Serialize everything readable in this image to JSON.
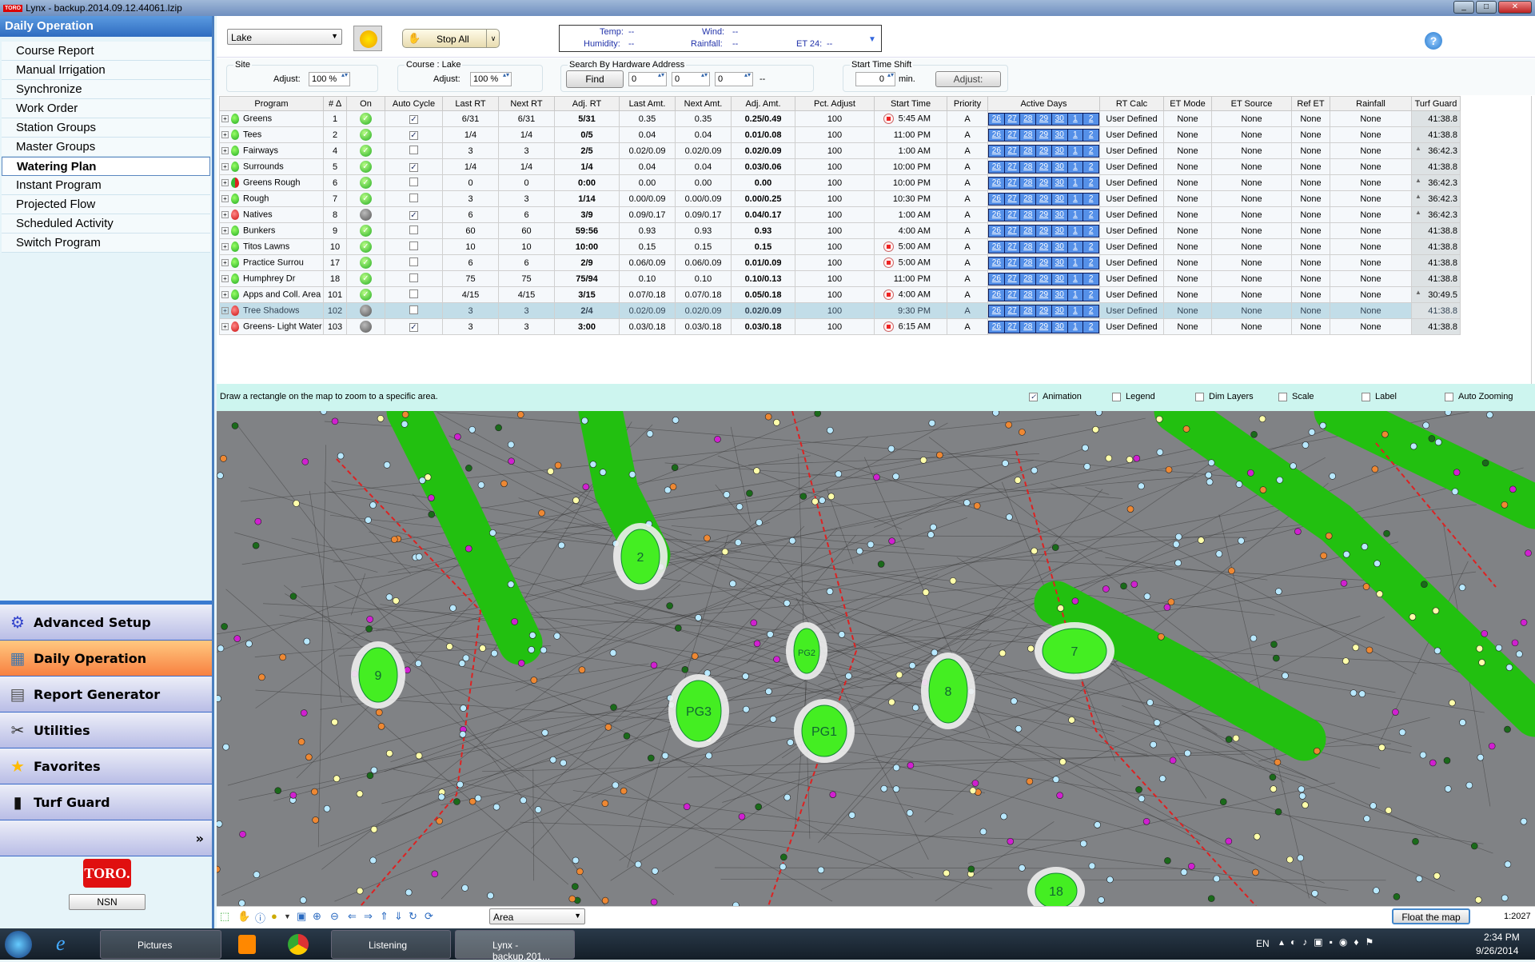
{
  "window": {
    "title": "Lynx - backup.2014.09.12.44061.lzip",
    "logo": "TORO"
  },
  "sidebar": {
    "header": "Daily Operation",
    "items": [
      {
        "label": "Course Report"
      },
      {
        "label": "Manual Irrigation"
      },
      {
        "label": "Synchronize"
      },
      {
        "label": "Work Order"
      },
      {
        "label": "Station Groups"
      },
      {
        "label": "Master Groups"
      },
      {
        "label": "Watering Plan",
        "selected": true
      },
      {
        "label": "Instant Program"
      },
      {
        "label": "Projected Flow"
      },
      {
        "label": "Scheduled Activity"
      },
      {
        "label": "Switch Program"
      }
    ],
    "modules": [
      {
        "label": "Advanced Setup",
        "icon": "gear-icon"
      },
      {
        "label": "Daily Operation",
        "icon": "calendar-icon",
        "active": true
      },
      {
        "label": "Report Generator",
        "icon": "report-icon"
      },
      {
        "label": "Utilities",
        "icon": "tools-icon"
      },
      {
        "label": "Favorites",
        "icon": "star-icon"
      },
      {
        "label": "Turf Guard",
        "icon": "sensor-icon"
      }
    ],
    "more": "»",
    "logo": "TORO.",
    "nsn_button": "NSN"
  },
  "toolbar": {
    "site_select": "Lake",
    "stop_all": "Stop All",
    "weather": {
      "temp_label": "Temp:",
      "temp": "--",
      "wind_label": "Wind:",
      "wind": "--",
      "humidity_label": "Humidity:",
      "humidity": "--",
      "rainfall_label": "Rainfall:",
      "rainfall": "--",
      "et24_label": "ET 24:",
      "et24": "--"
    },
    "help": "?"
  },
  "filters": {
    "site": {
      "legend": "Site",
      "adjust_label": "Adjust:",
      "adjust": "100 %"
    },
    "course": {
      "legend": "Course : Lake",
      "adjust_label": "Adjust:",
      "adjust": "100 %"
    },
    "hardware": {
      "legend": "Search By Hardware Address",
      "find": "Find",
      "a": "0",
      "b": "0",
      "c": "0",
      "dash": "--"
    },
    "shift": {
      "legend": "Start Time Shift",
      "value": "0",
      "unit": "min.",
      "adjust": "Adjust:"
    }
  },
  "table": {
    "columns": [
      "Program",
      "# ∆",
      "On",
      "Auto Cycle",
      "Last RT",
      "Next RT",
      "Adj. RT",
      "Last Amt.",
      "Next Amt.",
      "Adj. Amt.",
      "Pct. Adjust",
      "Start Time",
      "Priority",
      "Active Days",
      "RT Calc",
      "ET Mode",
      "ET Source",
      "Ref ET",
      "Rainfall",
      "Turf Guard"
    ],
    "days": [
      "26",
      "27",
      "28",
      "29",
      "30",
      "1",
      "2"
    ],
    "rows": [
      {
        "drop": "green",
        "program": "Greens",
        "num": "1",
        "on": true,
        "auto": true,
        "last_rt": "6/31",
        "next_rt": "6/31",
        "adj_rt": "5/31",
        "last_amt": "0.35",
        "next_amt": "0.35",
        "adj_amt": "0.25/0.49",
        "pct": "100",
        "stop": true,
        "start": "5:45 AM",
        "priority": "A",
        "rt_calc": "User Defined",
        "et_mode": "None",
        "et_source": "None",
        "ref_et": "None",
        "rainfall": "None",
        "turf": "41:38.8",
        "up": false
      },
      {
        "drop": "green",
        "program": "Tees",
        "num": "2",
        "on": true,
        "auto": true,
        "last_rt": "1/4",
        "next_rt": "1/4",
        "adj_rt": "0/5",
        "last_amt": "0.04",
        "next_amt": "0.04",
        "adj_amt": "0.01/0.08",
        "pct": "100",
        "stop": false,
        "start": "11:00 PM",
        "priority": "A",
        "rt_calc": "User Defined",
        "et_mode": "None",
        "et_source": "None",
        "ref_et": "None",
        "rainfall": "None",
        "turf": "41:38.8",
        "up": false
      },
      {
        "drop": "green",
        "program": "Fairways",
        "num": "4",
        "on": true,
        "auto": false,
        "last_rt": "3",
        "next_rt": "3",
        "adj_rt": "2/5",
        "last_amt": "0.02/0.09",
        "next_amt": "0.02/0.09",
        "adj_amt": "0.02/0.09",
        "pct": "100",
        "stop": false,
        "start": "1:00 AM",
        "priority": "A",
        "rt_calc": "User Defined",
        "et_mode": "None",
        "et_source": "None",
        "ref_et": "None",
        "rainfall": "None",
        "turf": "36:42.3",
        "up": true
      },
      {
        "drop": "green",
        "program": "Surrounds",
        "num": "5",
        "on": true,
        "auto": true,
        "last_rt": "1/4",
        "next_rt": "1/4",
        "adj_rt": "1/4",
        "last_amt": "0.04",
        "next_amt": "0.04",
        "adj_amt": "0.03/0.06",
        "pct": "100",
        "stop": false,
        "start": "10:00 PM",
        "priority": "A",
        "rt_calc": "User Defined",
        "et_mode": "None",
        "et_source": "None",
        "ref_et": "None",
        "rainfall": "None",
        "turf": "41:38.8",
        "up": false
      },
      {
        "drop": "mixed",
        "program": "Greens Rough",
        "num": "6",
        "on": true,
        "auto": false,
        "last_rt": "0",
        "next_rt": "0",
        "adj_rt": "0:00",
        "last_amt": "0.00",
        "next_amt": "0.00",
        "adj_amt": "0.00",
        "pct": "100",
        "stop": false,
        "start": "10:00 PM",
        "priority": "A",
        "rt_calc": "User Defined",
        "et_mode": "None",
        "et_source": "None",
        "ref_et": "None",
        "rainfall": "None",
        "turf": "36:42.3",
        "up": true
      },
      {
        "drop": "green",
        "program": "Rough",
        "num": "7",
        "on": true,
        "auto": false,
        "last_rt": "3",
        "next_rt": "3",
        "adj_rt": "1/14",
        "last_amt": "0.00/0.09",
        "next_amt": "0.00/0.09",
        "adj_amt": "0.00/0.25",
        "pct": "100",
        "stop": false,
        "start": "10:30 PM",
        "priority": "A",
        "rt_calc": "User Defined",
        "et_mode": "None",
        "et_source": "None",
        "ref_et": "None",
        "rainfall": "None",
        "turf": "36:42.3",
        "up": true
      },
      {
        "drop": "red",
        "program": "Natives",
        "num": "8",
        "on": false,
        "auto": true,
        "last_rt": "6",
        "next_rt": "6",
        "adj_rt": "3/9",
        "last_amt": "0.09/0.17",
        "next_amt": "0.09/0.17",
        "adj_amt": "0.04/0.17",
        "pct": "100",
        "stop": false,
        "start": "1:00 AM",
        "priority": "A",
        "rt_calc": "User Defined",
        "et_mode": "None",
        "et_source": "None",
        "ref_et": "None",
        "rainfall": "None",
        "turf": "36:42.3",
        "up": true
      },
      {
        "drop": "green",
        "program": "Bunkers",
        "num": "9",
        "on": true,
        "auto": false,
        "last_rt": "60",
        "next_rt": "60",
        "adj_rt": "59:56",
        "last_amt": "0.93",
        "next_amt": "0.93",
        "adj_amt": "0.93",
        "pct": "100",
        "stop": false,
        "start": "4:00 AM",
        "priority": "A",
        "rt_calc": "User Defined",
        "et_mode": "None",
        "et_source": "None",
        "ref_et": "None",
        "rainfall": "None",
        "turf": "41:38.8",
        "up": false
      },
      {
        "drop": "green",
        "program": "Titos Lawns",
        "num": "10",
        "on": true,
        "auto": false,
        "last_rt": "10",
        "next_rt": "10",
        "adj_rt": "10:00",
        "last_amt": "0.15",
        "next_amt": "0.15",
        "adj_amt": "0.15",
        "pct": "100",
        "stop": true,
        "start": "5:00 AM",
        "priority": "A",
        "rt_calc": "User Defined",
        "et_mode": "None",
        "et_source": "None",
        "ref_et": "None",
        "rainfall": "None",
        "turf": "41:38.8",
        "up": false
      },
      {
        "drop": "green",
        "program": "Practice Surrou",
        "num": "17",
        "on": true,
        "auto": false,
        "last_rt": "6",
        "next_rt": "6",
        "adj_rt": "2/9",
        "last_amt": "0.06/0.09",
        "next_amt": "0.06/0.09",
        "adj_amt": "0.01/0.09",
        "pct": "100",
        "stop": true,
        "start": "5:00 AM",
        "priority": "A",
        "rt_calc": "User Defined",
        "et_mode": "None",
        "et_source": "None",
        "ref_et": "None",
        "rainfall": "None",
        "turf": "41:38.8",
        "up": false
      },
      {
        "drop": "green",
        "program": "Humphrey Dr",
        "num": "18",
        "on": true,
        "auto": false,
        "last_rt": "75",
        "next_rt": "75",
        "adj_rt": "75/94",
        "last_amt": "0.10",
        "next_amt": "0.10",
        "adj_amt": "0.10/0.13",
        "pct": "100",
        "stop": false,
        "start": "11:00 PM",
        "priority": "A",
        "rt_calc": "User Defined",
        "et_mode": "None",
        "et_source": "None",
        "ref_et": "None",
        "rainfall": "None",
        "turf": "41:38.8",
        "up": false
      },
      {
        "drop": "green",
        "program": "Apps and Coll. Area",
        "num": "101",
        "on": true,
        "auto": false,
        "last_rt": "4/15",
        "next_rt": "4/15",
        "adj_rt": "3/15",
        "last_amt": "0.07/0.18",
        "next_amt": "0.07/0.18",
        "adj_amt": "0.05/0.18",
        "pct": "100",
        "stop": true,
        "start": "4:00 AM",
        "priority": "A",
        "rt_calc": "User Defined",
        "et_mode": "None",
        "et_source": "None",
        "ref_et": "None",
        "rainfall": "None",
        "turf": "30:49.5",
        "up": true
      },
      {
        "drop": "red",
        "program": "Tree Shadows",
        "num": "102",
        "on": false,
        "auto": false,
        "last_rt": "3",
        "next_rt": "3",
        "adj_rt": "2/4",
        "last_amt": "0.02/0.09",
        "next_amt": "0.02/0.09",
        "adj_amt": "0.02/0.09",
        "pct": "100",
        "stop": false,
        "start": "9:30 PM",
        "priority": "A",
        "rt_calc": "User Defined",
        "et_mode": "None",
        "et_source": "None",
        "ref_et": "None",
        "rainfall": "None",
        "turf": "41:38.8",
        "up": false,
        "selected": true
      },
      {
        "drop": "red",
        "program": "Greens- Light Water",
        "num": "103",
        "on": false,
        "auto": true,
        "last_rt": "3",
        "next_rt": "3",
        "adj_rt": "3:00",
        "last_amt": "0.03/0.18",
        "next_amt": "0.03/0.18",
        "adj_amt": "0.03/0.18",
        "pct": "100",
        "stop": true,
        "start": "6:15 AM",
        "priority": "A",
        "rt_calc": "User Defined",
        "et_mode": "None",
        "et_source": "None",
        "ref_et": "None",
        "rainfall": "None",
        "turf": "41:38.8",
        "up": false
      }
    ]
  },
  "map": {
    "hint": "Draw a rectangle on the map to zoom to a specific area.",
    "options": [
      {
        "label": "Animation",
        "checked": true
      },
      {
        "label": "Legend",
        "checked": false
      },
      {
        "label": "Dim Layers",
        "checked": false
      },
      {
        "label": "Scale",
        "checked": false
      },
      {
        "label": "Label",
        "checked": false
      },
      {
        "label": "Auto Zooming",
        "checked": false
      }
    ],
    "hole_labels": [
      "2",
      "9",
      "PG3",
      "PG2",
      "PG1",
      "8",
      "7",
      "18"
    ],
    "mode_select": "Area",
    "float_button": "Float the map",
    "scale": "1:2027"
  },
  "taskbar": {
    "items": [
      "Pictures",
      "Listening",
      "Lynx - backup.201..."
    ],
    "lang": "EN",
    "time": "2:34 PM",
    "date": "9/26/2014"
  }
}
